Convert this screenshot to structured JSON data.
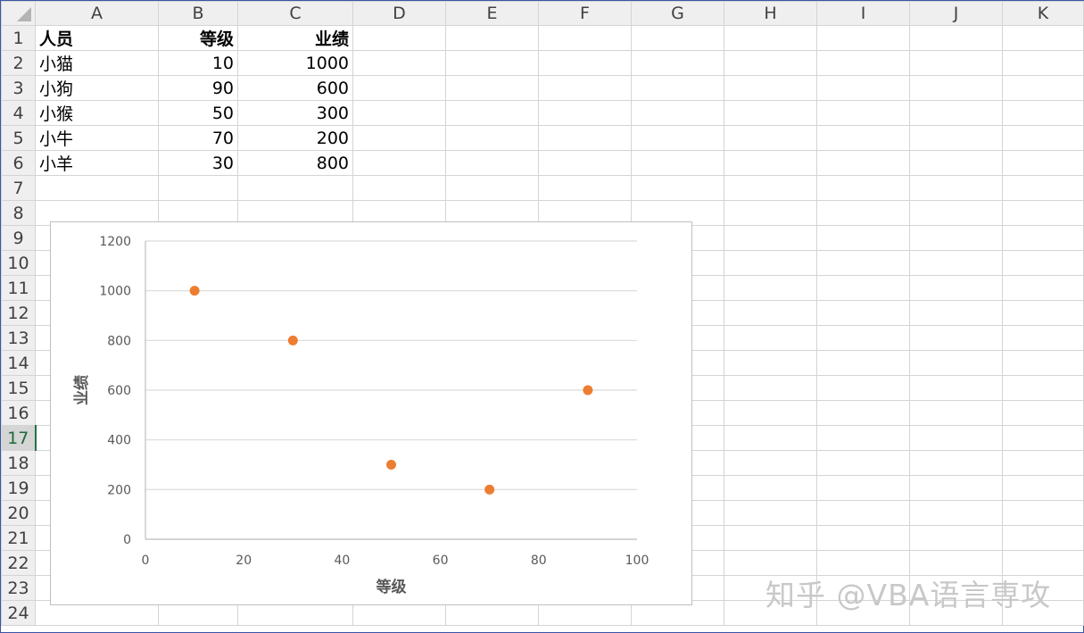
{
  "sheet": {
    "columns": [
      "A",
      "B",
      "C",
      "D",
      "E",
      "F",
      "G",
      "H",
      "I",
      "J",
      "K"
    ],
    "rows": [
      1,
      2,
      3,
      4,
      5,
      6,
      7,
      8,
      9,
      10,
      11,
      12,
      13,
      14,
      15,
      16,
      17,
      18,
      19,
      20,
      21,
      22,
      23,
      24
    ],
    "active_row": 17,
    "headers": {
      "person": "人员",
      "level": "等级",
      "performance": "业绩"
    },
    "data": [
      {
        "person": "小猫",
        "level": "10",
        "performance": "1000"
      },
      {
        "person": "小狗",
        "level": "90",
        "performance": "600"
      },
      {
        "person": "小猴",
        "level": "50",
        "performance": "300"
      },
      {
        "person": "小牛",
        "level": "70",
        "performance": "200"
      },
      {
        "person": "小羊",
        "level": "30",
        "performance": "800"
      }
    ]
  },
  "chart_data": {
    "type": "scatter",
    "title": "",
    "xlabel": "等级",
    "ylabel": "业绩",
    "xlim": [
      0,
      100
    ],
    "ylim": [
      0,
      1200
    ],
    "xticks": [
      0,
      20,
      40,
      60,
      80,
      100
    ],
    "yticks": [
      0,
      200,
      400,
      600,
      800,
      1000,
      1200
    ],
    "grid": "horizontal",
    "marker_color": "#ed7d31",
    "points": [
      {
        "x": 10,
        "y": 1000
      },
      {
        "x": 90,
        "y": 600
      },
      {
        "x": 50,
        "y": 300
      },
      {
        "x": 70,
        "y": 200
      },
      {
        "x": 30,
        "y": 800
      }
    ]
  },
  "watermark": "知乎 @VBA语言専攻"
}
